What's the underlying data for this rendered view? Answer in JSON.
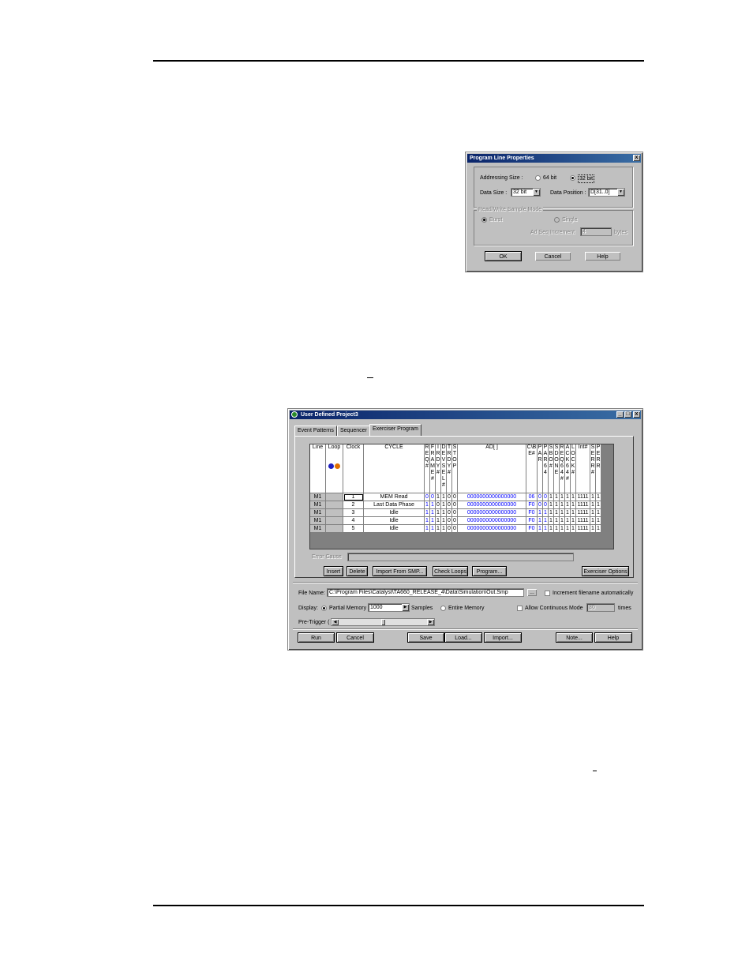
{
  "dialog": {
    "title": "Program Line Properties",
    "close": "x",
    "addressing_label": "Addressing Size :",
    "addr_64": "64 bit",
    "addr_32": "32 bit",
    "data_size_label": "Data Size :",
    "data_size_value": "32 bit",
    "data_pos_label": "Data Position :",
    "data_pos_value": "D[31..0]",
    "group_label": "Read/Write Sample Mode",
    "mode_burst": "Burst",
    "mode_single": "Single",
    "increment_label": "Ad Seq Increment",
    "increment_value": "4",
    "increment_unit": "bytes",
    "ok": "OK",
    "cancel": "Cancel",
    "help": "Help"
  },
  "project": {
    "title": "User Defined Project3",
    "tabs": [
      "Event Patterns",
      "Sequencer",
      "Exerciser Program"
    ],
    "columns": {
      "line": "Line",
      "loop": "Loop",
      "clock": "Clock",
      "cycle": "CYCLE",
      "req": "REQ#",
      "frame": "FRAME#",
      "irdy": "IRDY#",
      "devsel": "DEVSEL#",
      "trdy": "TRDY#",
      "stop": "STOP",
      "ad": "AD[ ]",
      "cbe": "C\\BE#",
      "par": "PAR",
      "par64": "PAR64",
      "sbo": "SBO#",
      "sdone": "SDONE",
      "req64": "REQ64#",
      "ack64": "ACK64#",
      "lock": "LOCK#",
      "intr": "Int#",
      "serr": "SERR#",
      "perr": "PERR"
    },
    "rows": [
      {
        "line": "M1",
        "clock": "1",
        "cycle": "MEM Read",
        "req": "0",
        "frame": "0",
        "irdy": "1",
        "devsel": "1",
        "trdy": "0",
        "stop": "0",
        "ad": "0000000000000000",
        "cbe": "06",
        "par": "0",
        "par64": "0",
        "sbo": "1",
        "sdone": "1",
        "req64": "1",
        "ack64": "1",
        "lock": "1",
        "intr": "1111",
        "serr": "1",
        "perr": "1"
      },
      {
        "line": "M1",
        "clock": "2",
        "cycle": "Last Data Phase",
        "req": "1",
        "frame": "1",
        "irdy": "0",
        "devsel": "1",
        "trdy": "0",
        "stop": "0",
        "ad": "0000000000000000",
        "cbe": "F0",
        "par": "0",
        "par64": "0",
        "sbo": "1",
        "sdone": "1",
        "req64": "1",
        "ack64": "1",
        "lock": "1",
        "intr": "1111",
        "serr": "1",
        "perr": "1"
      },
      {
        "line": "M1",
        "clock": "3",
        "cycle": "Idle",
        "req": "1",
        "frame": "1",
        "irdy": "1",
        "devsel": "1",
        "trdy": "0",
        "stop": "0",
        "ad": "0000000000000000",
        "cbe": "F0",
        "par": "1",
        "par64": "1",
        "sbo": "1",
        "sdone": "1",
        "req64": "1",
        "ack64": "1",
        "lock": "1",
        "intr": "1111",
        "serr": "1",
        "perr": "1"
      },
      {
        "line": "M1",
        "clock": "4",
        "cycle": "Idle",
        "req": "1",
        "frame": "1",
        "irdy": "1",
        "devsel": "1",
        "trdy": "0",
        "stop": "0",
        "ad": "0000000000000000",
        "cbe": "F0",
        "par": "1",
        "par64": "1",
        "sbo": "1",
        "sdone": "1",
        "req64": "1",
        "ack64": "1",
        "lock": "1",
        "intr": "1111",
        "serr": "1",
        "perr": "1"
      },
      {
        "line": "M1",
        "clock": "5",
        "cycle": "Idle",
        "req": "1",
        "frame": "1",
        "irdy": "1",
        "devsel": "1",
        "trdy": "0",
        "stop": "0",
        "ad": "0000000000000000",
        "cbe": "F0",
        "par": "1",
        "par64": "1",
        "sbo": "1",
        "sdone": "1",
        "req64": "1",
        "ack64": "1",
        "lock": "1",
        "intr": "1111",
        "serr": "1",
        "perr": "1"
      }
    ],
    "error_label": "Error Cause",
    "buttons_mid": [
      "Insert",
      "Delete",
      "Import From SMP...",
      "Check Loops",
      "Program...",
      "Exerciser Options"
    ],
    "file_name_label": "File Name:",
    "file_name_value": "C:\\Program Files\\Catalyst\\TA660_RELEASE_4\\Data\\Simulation\\Out.Smp",
    "browse": "...",
    "increment_filename": "Increment filename automatically",
    "display_label": "Display:",
    "partial_memory": "Partial Memory",
    "samples_value": "1000",
    "samples_label": "Samples",
    "entire_memory": "Entire Memory",
    "allow_continuous": "Allow Continuous Mode",
    "times_value": "30",
    "times_label": "times",
    "pretrigger_label": "Pre-Trigger ( 50 % ) :",
    "pretrigger_percent": 50,
    "buttons_bottom": [
      "Run",
      "Cancel",
      "Save",
      "Load...",
      "Import...",
      "Note...",
      "Help"
    ]
  }
}
